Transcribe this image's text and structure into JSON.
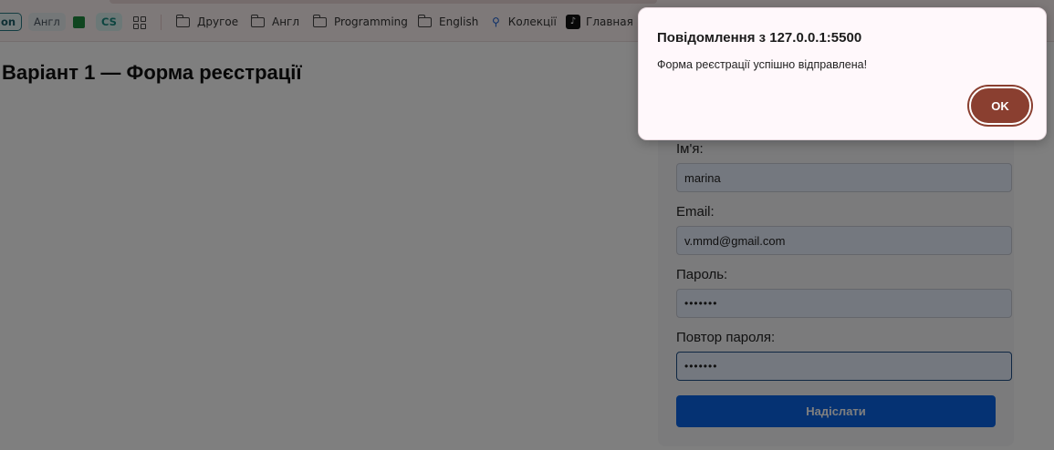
{
  "bookmarks": {
    "chip_on": "on",
    "chip_angl": "Англ",
    "chip_cs": "CS",
    "items": [
      {
        "label": "Другое",
        "icon": "folder-icon"
      },
      {
        "label": "Англ",
        "icon": "folder-icon"
      },
      {
        "label": "Programming",
        "icon": "folder-icon"
      },
      {
        "label": "English",
        "icon": "folder-icon"
      },
      {
        "label": "Колекції",
        "icon": "search-icon"
      },
      {
        "label": "Главная | F",
        "icon": "tiktok-icon"
      }
    ]
  },
  "page": {
    "title": "Варіант 1 — Форма реєстрації",
    "form": {
      "name_label": "Ім'я:",
      "name_value": "marina",
      "email_label": "Email:",
      "email_value": "v.mmd@gmail.com",
      "password_label": "Пароль:",
      "password_value": "•••••••",
      "repeat_label": "Повтор пароля:",
      "repeat_value": "•••••••",
      "submit_label": "Надіслати"
    }
  },
  "dialog": {
    "title": "Повідомлення з 127.0.0.1:5500",
    "message": "Форма реєстрації успішно відправлена!",
    "ok_label": "OK"
  },
  "colors": {
    "accent": "#0a64e6",
    "ok_button": "#8a3f30",
    "overlay": "rgba(0,0,0,0.5)"
  }
}
